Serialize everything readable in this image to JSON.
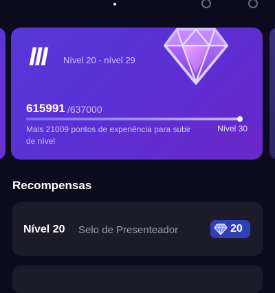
{
  "level_card": {
    "tier_numeral": "III",
    "level_range": "Nível 20 - nível 29",
    "xp_current": "615991",
    "xp_total": "/637000",
    "progress_fraction": 0.967,
    "xp_hint": "Mais 21009 pontos de experiência para subir de nível",
    "next_level": "Nível 30",
    "badge_icon": "diamond-icon"
  },
  "rewards": {
    "title": "Recompensas",
    "items": [
      {
        "level": "Nível 20",
        "name": "Selo de Presenteador",
        "badge_value": "20",
        "badge_icon": "diamond-icon"
      }
    ]
  },
  "colors": {
    "background": "#0c0b1d",
    "card_start": "#5638d9",
    "card_end": "#6a27c9",
    "badge": "#2f3fb8"
  }
}
